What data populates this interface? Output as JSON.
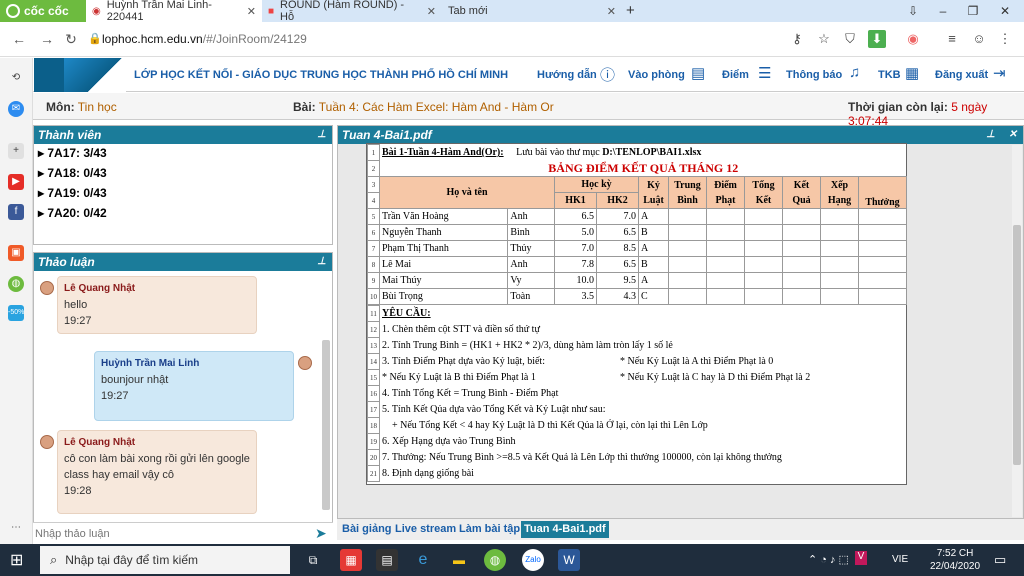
{
  "browser": {
    "brand_label": "cốc cốc",
    "tabs": [
      {
        "label": "Huỳnh Trần Mai Linh-220441",
        "active": true
      },
      {
        "label": "ROUND (Hàm ROUND) - Hỗ",
        "active": false
      },
      {
        "label": "Tab mới",
        "active": false
      }
    ],
    "new_tab_label": "+",
    "url_host": "lophoc.hcm.edu.vn",
    "url_path": "/#/JoinRoom/24129"
  },
  "site": {
    "title": "LỚP HỌC KẾT NỐI -  GIÁO DỤC TRUNG HỌC THÀNH PHỐ HỒ CHÍ MINH",
    "nav": [
      {
        "label": "Hướng dẫn",
        "icon": "help-icon"
      },
      {
        "label": "Vào phòng",
        "icon": "book-icon"
      },
      {
        "label": "Điểm",
        "icon": "list-icon"
      },
      {
        "label": "Thông báo",
        "icon": "bell-icon"
      },
      {
        "label": "TKB",
        "icon": "calendar-icon"
      },
      {
        "label": "Đăng xuất",
        "icon": "logout-icon"
      }
    ]
  },
  "subject": {
    "mon_label": "Môn:",
    "mon_value": "Tin học",
    "bai_label": "Bài:",
    "bai_value": "Tuần 4: Các Hàm Excel: Hàm And - Hàm Or",
    "time_label": "Thời gian còn lại:",
    "time_value": "5 ngày 3:07:44"
  },
  "members": {
    "title": "Thành viên",
    "items": [
      "7A17: 3/43",
      "7A18: 0/43",
      "7A19: 0/43",
      "7A20: 0/42"
    ]
  },
  "discussion": {
    "title": "Thảo luận",
    "messages": [
      {
        "name": "Lê Quang Nhật",
        "text": "hello",
        "time": "19:27"
      },
      {
        "name": "Huỳnh Trần Mai Linh",
        "text": "bounjour nhật",
        "time": "19:27"
      },
      {
        "name": "Lê Quang Nhật",
        "text": "cô con làm bài xong rồi gửi lên google class hay email vậy cô",
        "time": "19:28"
      }
    ],
    "input_placeholder": "Nhập thảo luận"
  },
  "pdf": {
    "title": "Tuan 4-Bai1.pdf",
    "row1_title": "Bài 1-Tuần 4-Hàm And(Or):",
    "row1_save": "Lưu bài vào thư mục",
    "row1_path": "D:\\TENLOP\\BAI1.xlsx",
    "sheet_title": "BẢNG ĐIỂM KẾT QUẢ THÁNG 12",
    "headers": {
      "hoten": "Họ và tên",
      "hocky": "Học kỳ",
      "hk1": "HK1",
      "hk2": "HK2",
      "kyluat": "Kỷ Luật",
      "trungbinh": "Trung Bình",
      "diemphat": "Điểm Phạt",
      "tongket": "Tổng Kết",
      "ketqua": "Kết Quả",
      "xephang": "Xếp Hạng",
      "thuong": "Thưởng"
    },
    "students": [
      {
        "row": "5",
        "ho": "Trần Văn Hoàng",
        "ten": "Anh",
        "hk1": "6.5",
        "hk2": "7.0",
        "kl": "A"
      },
      {
        "row": "6",
        "ho": "Nguyễn Thanh",
        "ten": "Bình",
        "hk1": "5.0",
        "hk2": "6.5",
        "kl": "B"
      },
      {
        "row": "7",
        "ho": "Phạm Thị Thanh",
        "ten": "Thủy",
        "hk1": "7.0",
        "hk2": "8.5",
        "kl": "A"
      },
      {
        "row": "8",
        "ho": "Lê Mai",
        "ten": "Anh",
        "hk1": "7.8",
        "hk2": "6.5",
        "kl": "B"
      },
      {
        "row": "9",
        "ho": "Mai Thúy",
        "ten": "Vy",
        "hk1": "10.0",
        "hk2": "9.5",
        "kl": "A"
      },
      {
        "row": "10",
        "ho": "Bùi Trọng",
        "ten": "Toàn",
        "hk1": "3.5",
        "hk2": "4.3",
        "kl": "C"
      }
    ],
    "requirements": [
      {
        "row": "11",
        "text": "YÊU CẦU:"
      },
      {
        "row": "12",
        "text": "1. Chèn thêm cột STT và điền số thứ tự"
      },
      {
        "row": "13",
        "text": "2. Tính Trung Bình = (HK1 + HK2 * 2)/3, dùng hàm làm tròn lấy 1 số lẻ"
      },
      {
        "row": "14",
        "text": "3. Tính Điểm Phạt dựa vào Kỷ luật, biết:",
        "extra": "* Nếu Kỷ Luật là A thì Điểm Phạt là 0"
      },
      {
        "row": "15",
        "text": "* Nếu Kỷ Luật là B thì Điểm Phạt là 1",
        "extra": "* Nếu Kỷ Luật là C hay là D thì Điểm Phạt là 2"
      },
      {
        "row": "16",
        "text": "4. Tính Tổng Kết = Trung Bình - Điểm Phạt"
      },
      {
        "row": "17",
        "text": "5. Tính Kết Qủa dựa vào Tổng Kết và Kỷ Luật như sau:"
      },
      {
        "row": "18",
        "text": "    + Nếu Tổng Kết < 4 hay Kỷ Luật là D thì Kết Qủa là Ở lại, còn lại thì Lên Lớp"
      },
      {
        "row": "19",
        "text": "6. Xếp Hạng dựa vào Trung Bình"
      },
      {
        "row": "20",
        "text": "7. Thưởng: Nếu Trung Bình >=8.5 và Kết Quả là Lên Lớp thì thưởng 100000, còn lại không thưởng"
      },
      {
        "row": "21",
        "text": "8. Định dạng giống bài"
      }
    ]
  },
  "bottom_tabs": [
    "Bài giảng",
    "Live stream",
    "Làm bài tập",
    "Tuan 4-Bai1.pdf"
  ],
  "taskbar": {
    "search_placeholder": "Nhập tại đây để tìm kiếm",
    "lang": "VIE",
    "time": "7:52 CH",
    "date": "22/04/2020"
  }
}
